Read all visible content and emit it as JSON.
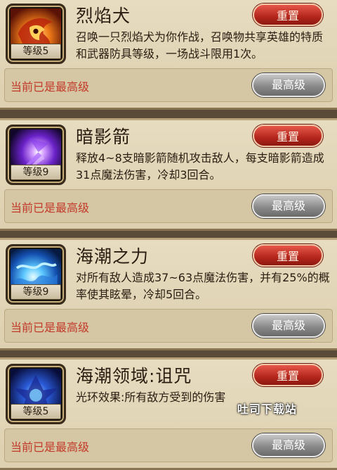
{
  "skills": [
    {
      "name": "烈焰犬",
      "level": "等级5",
      "description": "召唤一只烈焰犬为你作战，召唤物共享英雄的特质和武器防具等级，一场战斗限用1次。",
      "reset_label": "重置",
      "status": "当前已是最高级",
      "max_label": "最高级",
      "icon": "flame-hound-icon"
    },
    {
      "name": "暗影箭",
      "level": "等级9",
      "description": "释放4~8支暗影箭随机攻击敌人，每支暗影箭造成31点魔法伤害，冷却3回合。",
      "reset_label": "重置",
      "status": "当前已是最高级",
      "max_label": "最高级",
      "icon": "shadow-arrow-icon"
    },
    {
      "name": "海潮之力",
      "level": "等级9",
      "description": "对所有敌人造成37~63点魔法伤害，并有25%的概率使其眩晕，冷却5回合。",
      "reset_label": "重置",
      "status": "当前已是最高级",
      "max_label": "最高级",
      "icon": "tide-power-icon"
    },
    {
      "name": "海潮领域:诅咒",
      "level": "等级5",
      "description": "光环效果:所有敌方受到的伤害",
      "reset_label": "重置",
      "status": "当前已是最高级",
      "max_label": "最高级",
      "icon": "tide-domain-curse-icon"
    }
  ],
  "watermark": "吐司下载站",
  "colors": {
    "card_background": "#e3d7b9",
    "reset_button": "#c4302a",
    "max_button": "#8a8a8a",
    "status_text": "#c23a2a"
  }
}
